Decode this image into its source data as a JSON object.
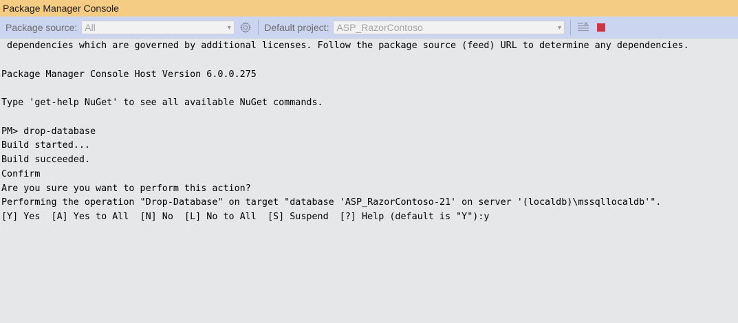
{
  "window": {
    "title": "Package Manager Console"
  },
  "toolbar": {
    "package_source_label": "Package source:",
    "package_source_value": "All",
    "settings_icon": "gear-icon",
    "default_project_label": "Default project:",
    "default_project_value": "ASP_RazorContoso",
    "clear_icon": "clear-console-icon",
    "stop_icon": "stop-icon",
    "stop_color": "#d1343f"
  },
  "console": {
    "lines": [
      " dependencies which are governed by additional licenses. Follow the package source (feed) URL to determine any dependencies.",
      "",
      "Package Manager Console Host Version 6.0.0.275",
      "",
      "Type 'get-help NuGet' to see all available NuGet commands.",
      "",
      "PM> drop-database",
      "Build started...",
      "Build succeeded.",
      "Confirm",
      "Are you sure you want to perform this action?",
      "Performing the operation \"Drop-Database\" on target \"database 'ASP_RazorContoso-21' on server '(localdb)\\mssqllocaldb'\".",
      "[Y] Yes  [A] Yes to All  [N] No  [L] No to All  [S] Suspend  [?] Help (default is \"Y\"):y"
    ]
  }
}
